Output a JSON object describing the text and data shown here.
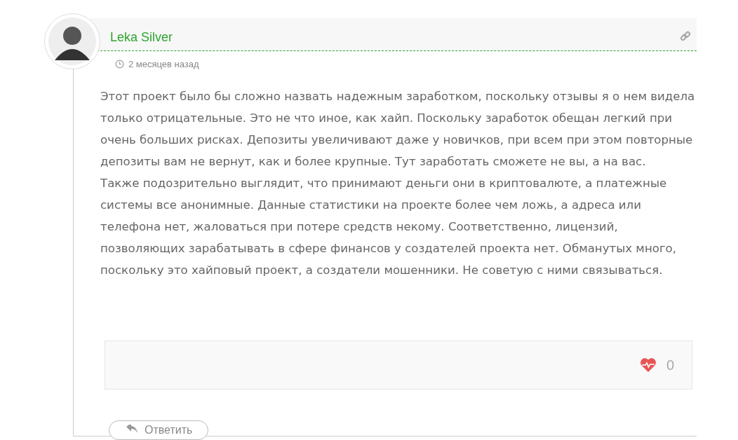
{
  "comment": {
    "author": "Leka Silver",
    "time": "2 месяцев назад",
    "paragraphs": [
      "Этот проект было бы сложно назвать надежным заработком, поскольку отзывы я о нем видела только отрицательные. Это не что иное, как хайп. Поскольку заработок обещан легкий при очень больших рисках. Депозиты увеличивают даже у новичков, при всем при этом повторные депозиты вам не вернут, как и более крупные. Тут заработать сможете не вы, а на вас.",
      "Также подозрительно выглядит, что принимают деньги они в криптовалюте, а платежные системы все анонимные. Данные статистики на проекте более чем ложь, а адреса или телефона нет, жаловаться при потере средств некому. Соответственно, лицензий, позволяющих зарабатывать в сфере финансов у создателей проекта нет. Обманутых много, поскольку это хайповый проект, а создатели мошенники. Не советую с ними связываться."
    ],
    "likes": "0",
    "reply_button": "Ответить"
  }
}
